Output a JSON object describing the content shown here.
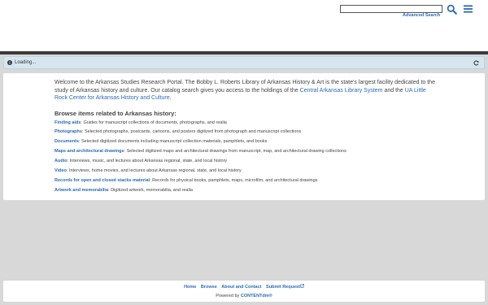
{
  "header": {
    "search_placeholder": "",
    "advanced_search": "Advanced Search"
  },
  "loading": {
    "text": "Loading..."
  },
  "intro": {
    "text1": "Welcome to the Arkansas Studies Research Portal. The Bobby L. Roberts Library of Arkansas History & Art is the state's largest facility dedicated to the study of Arkansas history and culture. Our catalog search gives you access to the holdings of the ",
    "link1": "Central Arkansas Library System",
    "text2": " and the ",
    "link2": "UA Little Rock Center for Arkansas History and Culture",
    "text3": "."
  },
  "browse_heading": "Browse items related to Arkansas history:",
  "browse_items": [
    {
      "label": "Finding aids",
      "desc": ": Guides for manuscript collections of documents, photographs, and realia"
    },
    {
      "label": "Photographs",
      "desc": ": Selected photographs, postcards, cartoons, and posters digitized from photograph and manuscript collections"
    },
    {
      "label": "Documents",
      "desc": ": Selected digitized documents including manuscript collection materials, pamphlets, and books"
    },
    {
      "label": "Maps and architectural drawings",
      "desc": ": Selected digitized maps and architectural drawings from manuscript, map, and architectural drawing collections"
    },
    {
      "label": "Audio",
      "desc": ": Interviews, music, and lectures about Arkansas regional, state, and local history"
    },
    {
      "label": "Video",
      "desc": ": Interviews, home movies, and lectures about Arkansas regional, state, and local history"
    },
    {
      "label": "Records for open and closed stacks material",
      "desc": ": Records for physical books, pamphlets, maps, microfilm, and architectural drawings"
    },
    {
      "label": "Artwork and memorabilia",
      "desc": ": Digitized artwork, memorabilia, and realia"
    }
  ],
  "footer": {
    "links": [
      "Home",
      "Browse",
      "About and Contact",
      "Submit Request"
    ],
    "powered_prefix": "Powered by ",
    "powered_brand": "CONTENTdm®"
  },
  "icons": {
    "search": "search-icon",
    "menu": "hamburger-menu-icon",
    "info": "info-circle-icon",
    "refresh": "refresh-icon",
    "external": "external-link-icon"
  },
  "colors": {
    "link": "#2a6bb8",
    "loading_bg": "#d5e6f0",
    "topline": "#3a3a3a",
    "page_bg": "#d8d8d8"
  }
}
